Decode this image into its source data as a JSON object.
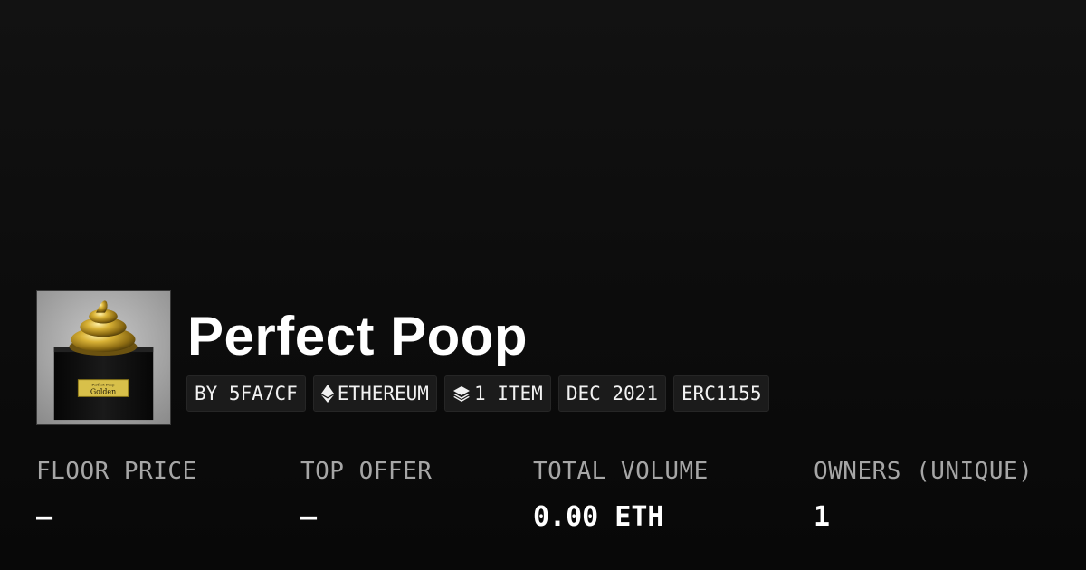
{
  "collection": {
    "name": "Perfect Poop",
    "thumbnail": {
      "plaque_small_text": "Perfect Poop",
      "plaque_text": "Golden"
    }
  },
  "tags": [
    {
      "label": "BY 5FA7CF",
      "icon": null
    },
    {
      "label": "ETHEREUM",
      "icon": "ethereum-icon"
    },
    {
      "label": "1 ITEM",
      "icon": "layers-icon"
    },
    {
      "label": "DEC 2021",
      "icon": null
    },
    {
      "label": "ERC1155",
      "icon": null
    }
  ],
  "stats": [
    {
      "label": "FLOOR PRICE",
      "value": "—"
    },
    {
      "label": "TOP OFFER",
      "value": "—"
    },
    {
      "label": "TOTAL VOLUME",
      "value": "0.00 ETH"
    },
    {
      "label": "OWNERS (UNIQUE)",
      "value": "1"
    }
  ],
  "colors": {
    "background": "#0b0b0b",
    "text_primary": "#ffffff",
    "text_secondary": "#a6a6a6",
    "tag_background": "#1b1b1b",
    "gold": "#c9a227"
  }
}
